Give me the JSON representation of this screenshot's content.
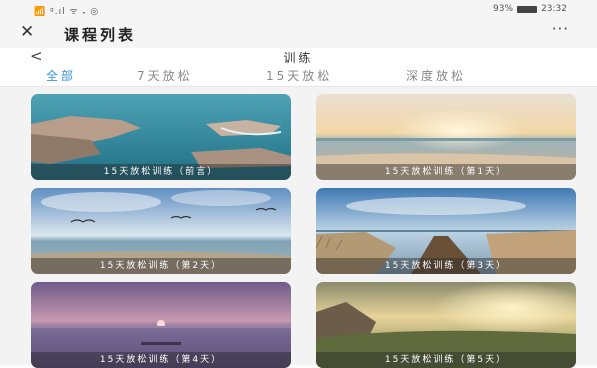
{
  "status_bar": {
    "left": "📶 ᵍ.ıl ᯤ 𝅏 ◎",
    "battery": "93%",
    "time": "23:32"
  },
  "app_bar": {
    "close_icon": "close-icon",
    "title": "课程列表",
    "more": "···"
  },
  "page": {
    "back": "<",
    "title": "训练"
  },
  "tabs": [
    {
      "label": "全部",
      "active": true
    },
    {
      "label": "7天放松",
      "active": false
    },
    {
      "label": "15天放松",
      "active": false
    },
    {
      "label": "深度放松",
      "active": false
    }
  ],
  "courses": [
    {
      "caption": "15天放松训练（前言）"
    },
    {
      "caption": "15天放松训练（第1天）"
    },
    {
      "caption": "15天放松训练（第2天）"
    },
    {
      "caption": "15天放松训练（第3天）"
    },
    {
      "caption": "15天放松训练（第4天）"
    },
    {
      "caption": "15天放松训练（第5天）"
    }
  ],
  "colors": {
    "accent": "#3a93d8",
    "tab_inactive": "#888888",
    "background": "#f3f3f3"
  }
}
